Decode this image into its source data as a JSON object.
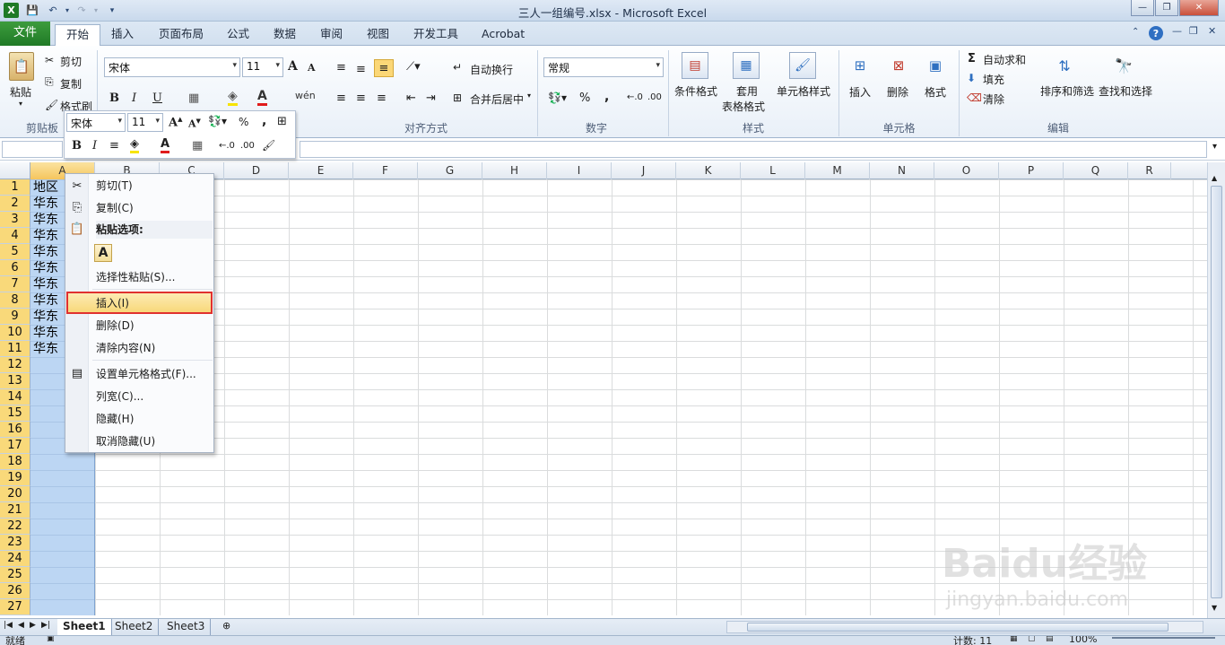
{
  "title": "三人一组编号.xlsx  -  Microsoft Excel",
  "tabs": {
    "file": "文件",
    "home": "开始",
    "insert": "插入",
    "layout": "页面布局",
    "formulas": "公式",
    "data": "数据",
    "review": "审阅",
    "view": "视图",
    "developer": "开发工具",
    "acrobat": "Acrobat"
  },
  "ribbon": {
    "clipboard": {
      "paste": "粘贴",
      "cut": "剪切",
      "copy": "复制",
      "format_painter": "格式刷",
      "label": "剪贴板"
    },
    "font": {
      "name": "宋体",
      "size": "11",
      "bold": "B",
      "italic": "I",
      "underline": "U",
      "grow": "A",
      "shrink": "A"
    },
    "alignment": {
      "wrap": "自动换行",
      "merge": "合并后居中",
      "label": "对齐方式"
    },
    "number": {
      "format": "常规",
      "percent": "%",
      "comma": ",",
      "label": "数字"
    },
    "styles": {
      "conditional": "条件格式",
      "table1": "套用",
      "table2": "表格格式",
      "cell_styles": "单元格样式",
      "label": "样式"
    },
    "cells": {
      "insert": "插入",
      "delete": "删除",
      "format": "格式",
      "label": "单元格"
    },
    "editing": {
      "autosum": "自动求和",
      "fill": "填充",
      "clear": "清除",
      "sort": "排序和筛选",
      "find": "查找和选择",
      "label": "编辑"
    }
  },
  "minitoolbar": {
    "font": "宋体",
    "size": "11",
    "bold": "B",
    "italic": "I",
    "percent": "%",
    "comma": ","
  },
  "columns": [
    "A",
    "B",
    "C",
    "D",
    "E",
    "F",
    "G",
    "H",
    "I",
    "J",
    "K",
    "L",
    "M",
    "N",
    "O",
    "P",
    "Q",
    "R"
  ],
  "rows": [
    "1",
    "2",
    "3",
    "4",
    "5",
    "6",
    "7",
    "8",
    "9",
    "10",
    "11",
    "12",
    "13",
    "14",
    "15",
    "16",
    "17",
    "18",
    "19",
    "20",
    "21",
    "22",
    "23",
    "24",
    "25",
    "26",
    "27"
  ],
  "cells_a": [
    "地区",
    "华东",
    "华东",
    "华东",
    "华东",
    "华东",
    "华东",
    "华东",
    "华东",
    "华东",
    "华东"
  ],
  "context_menu": {
    "cut": "剪切(T)",
    "copy": "复制(C)",
    "paste_options": "粘贴选项:",
    "paste_A": "A",
    "paste_special": "选择性粘贴(S)...",
    "insert": "插入(I)",
    "delete": "删除(D)",
    "clear": "清除内容(N)",
    "format_cells": "设置单元格格式(F)...",
    "col_width": "列宽(C)...",
    "hide": "隐藏(H)",
    "unhide": "取消隐藏(U)"
  },
  "sheets": [
    "Sheet1",
    "Sheet2",
    "Sheet3"
  ],
  "status": {
    "ready": "就绪",
    "count": "计数: 11",
    "zoom": "100%"
  },
  "watermark": {
    "brand": "Baidu经验",
    "url": "jingyan.baidu.com"
  }
}
